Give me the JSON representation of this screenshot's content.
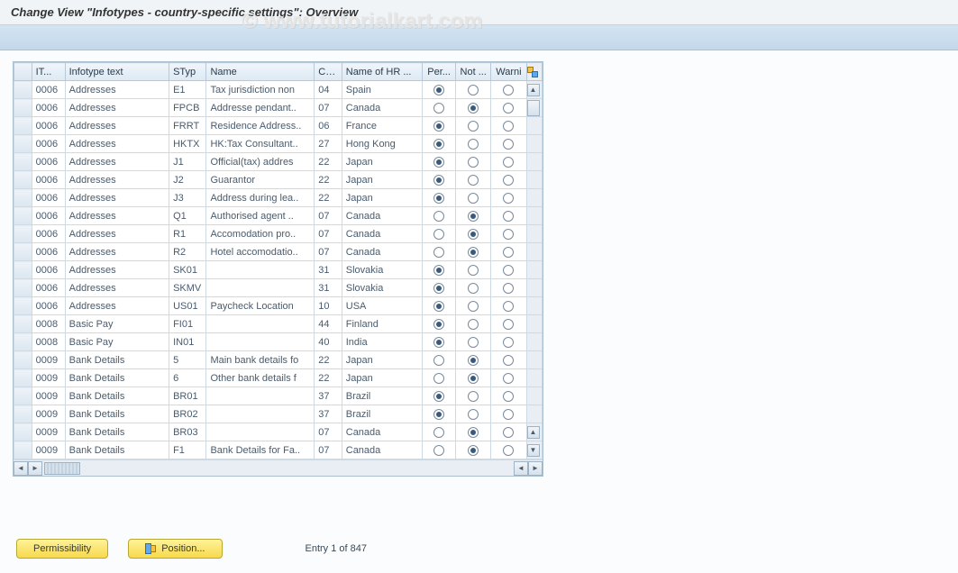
{
  "title": "Change View \"Infotypes - country-specific settings\": Overview",
  "watermark": "© www.tutorialkart.com",
  "columns": {
    "it": "IT...",
    "text": "Infotype text",
    "styp": "STyp",
    "name": "Name",
    "cg": "CG...",
    "hr": "Name of HR ...",
    "per": "Per...",
    "not": "Not ...",
    "warn": "Warni"
  },
  "rows": [
    {
      "it": "0006",
      "text": "Addresses",
      "styp": "E1",
      "name": "Tax jurisdiction non",
      "cg": "04",
      "hr": "Spain",
      "per": true,
      "not": false,
      "warn": false
    },
    {
      "it": "0006",
      "text": "Addresses",
      "styp": "FPCB",
      "name": "Addresse pendant..",
      "cg": "07",
      "hr": "Canada",
      "per": false,
      "not": true,
      "warn": false
    },
    {
      "it": "0006",
      "text": "Addresses",
      "styp": "FRRT",
      "name": "Residence Address..",
      "cg": "06",
      "hr": "France",
      "per": true,
      "not": false,
      "warn": false
    },
    {
      "it": "0006",
      "text": "Addresses",
      "styp": "HKTX",
      "name": "HK:Tax Consultant..",
      "cg": "27",
      "hr": "Hong Kong",
      "per": true,
      "not": false,
      "warn": false
    },
    {
      "it": "0006",
      "text": "Addresses",
      "styp": "J1",
      "name": "Official(tax) addres",
      "cg": "22",
      "hr": "Japan",
      "per": true,
      "not": false,
      "warn": false
    },
    {
      "it": "0006",
      "text": "Addresses",
      "styp": "J2",
      "name": "Guarantor",
      "cg": "22",
      "hr": "Japan",
      "per": true,
      "not": false,
      "warn": false
    },
    {
      "it": "0006",
      "text": "Addresses",
      "styp": "J3",
      "name": "Address during lea..",
      "cg": "22",
      "hr": "Japan",
      "per": true,
      "not": false,
      "warn": false
    },
    {
      "it": "0006",
      "text": "Addresses",
      "styp": "Q1",
      "name": "Authorised agent ..",
      "cg": "07",
      "hr": "Canada",
      "per": false,
      "not": true,
      "warn": false
    },
    {
      "it": "0006",
      "text": "Addresses",
      "styp": "R1",
      "name": "Accomodation pro..",
      "cg": "07",
      "hr": "Canada",
      "per": false,
      "not": true,
      "warn": false
    },
    {
      "it": "0006",
      "text": "Addresses",
      "styp": "R2",
      "name": "Hotel accomodatio..",
      "cg": "07",
      "hr": "Canada",
      "per": false,
      "not": true,
      "warn": false
    },
    {
      "it": "0006",
      "text": "Addresses",
      "styp": "SK01",
      "name": "",
      "cg": "31",
      "hr": "Slovakia",
      "per": true,
      "not": false,
      "warn": false
    },
    {
      "it": "0006",
      "text": "Addresses",
      "styp": "SKMV",
      "name": "",
      "cg": "31",
      "hr": "Slovakia",
      "per": true,
      "not": false,
      "warn": false
    },
    {
      "it": "0006",
      "text": "Addresses",
      "styp": "US01",
      "name": "Paycheck Location",
      "cg": "10",
      "hr": "USA",
      "per": true,
      "not": false,
      "warn": false
    },
    {
      "it": "0008",
      "text": "Basic Pay",
      "styp": "FI01",
      "name": "",
      "cg": "44",
      "hr": "Finland",
      "per": true,
      "not": false,
      "warn": false
    },
    {
      "it": "0008",
      "text": "Basic Pay",
      "styp": "IN01",
      "name": "",
      "cg": "40",
      "hr": "India",
      "per": true,
      "not": false,
      "warn": false
    },
    {
      "it": "0009",
      "text": "Bank Details",
      "styp": "5",
      "name": "Main bank details fo",
      "cg": "22",
      "hr": "Japan",
      "per": false,
      "not": true,
      "warn": false
    },
    {
      "it": "0009",
      "text": "Bank Details",
      "styp": "6",
      "name": "Other bank details f",
      "cg": "22",
      "hr": "Japan",
      "per": false,
      "not": true,
      "warn": false
    },
    {
      "it": "0009",
      "text": "Bank Details",
      "styp": "BR01",
      "name": "",
      "cg": "37",
      "hr": "Brazil",
      "per": true,
      "not": false,
      "warn": false
    },
    {
      "it": "0009",
      "text": "Bank Details",
      "styp": "BR02",
      "name": "",
      "cg": "37",
      "hr": "Brazil",
      "per": true,
      "not": false,
      "warn": false
    },
    {
      "it": "0009",
      "text": "Bank Details",
      "styp": "BR03",
      "name": "",
      "cg": "07",
      "hr": "Canada",
      "per": false,
      "not": true,
      "warn": false
    },
    {
      "it": "0009",
      "text": "Bank Details",
      "styp": "F1",
      "name": "Bank Details for Fa..",
      "cg": "07",
      "hr": "Canada",
      "per": false,
      "not": true,
      "warn": false
    }
  ],
  "footer": {
    "permissibility": "Permissibility",
    "position": "Position...",
    "entry": "Entry 1 of 847"
  }
}
